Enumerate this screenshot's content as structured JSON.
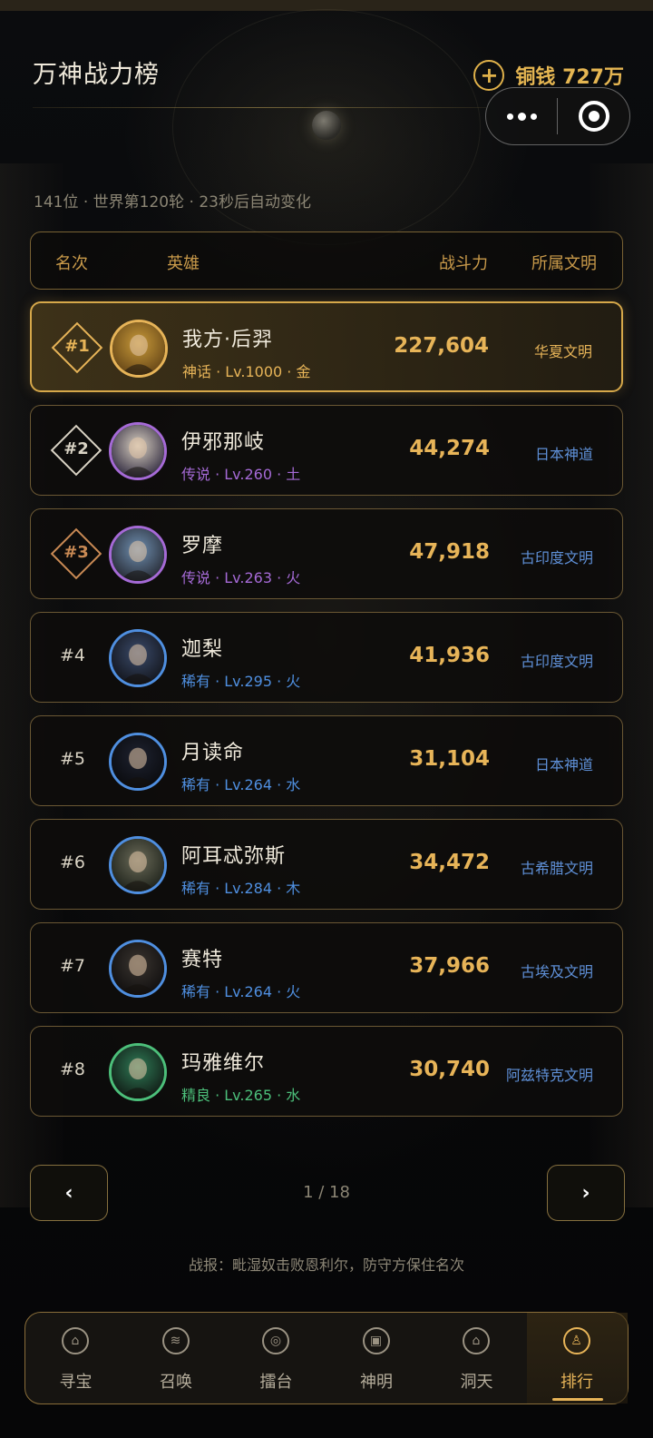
{
  "header": {
    "title": "万神战力榜",
    "coin_label": "铜钱 727万",
    "coin_add_icon": "plus-circle-icon"
  },
  "capsule": {
    "more_icon": "more-dots-icon",
    "close_icon": "target-icon"
  },
  "subinfo": "141位 · 世界第120轮 · 23秒后自动变化",
  "table_header": {
    "rank": "名次",
    "hero": "英雄",
    "power": "战斗力",
    "civ": "所属文明"
  },
  "rows": [
    {
      "rank": "#1",
      "name": "我方·后羿",
      "meta": "神话 · Lv.1000 · 金",
      "power": "227,604",
      "civ": "华夏文明",
      "rarity_color": "#e7b458"
    },
    {
      "rank": "#2",
      "name": "伊邪那岐",
      "meta": "传说 · Lv.260 · 土",
      "power": "44,274",
      "civ": "日本神道",
      "rarity_color": "#a56ad6"
    },
    {
      "rank": "#3",
      "name": "罗摩",
      "meta": "传说 · Lv.263 · 火",
      "power": "47,918",
      "civ": "古印度文明",
      "rarity_color": "#a56ad6"
    },
    {
      "rank": "#4",
      "name": "迦梨",
      "meta": "稀有 · Lv.295 · 火",
      "power": "41,936",
      "civ": "古印度文明",
      "rarity_color": "#4f8fe0"
    },
    {
      "rank": "#5",
      "name": "月读命",
      "meta": "稀有 · Lv.264 · 水",
      "power": "31,104",
      "civ": "日本神道",
      "rarity_color": "#4f8fe0"
    },
    {
      "rank": "#6",
      "name": "阿耳忒弥斯",
      "meta": "稀有 · Lv.284 · 木",
      "power": "34,472",
      "civ": "古希腊文明",
      "rarity_color": "#4f8fe0"
    },
    {
      "rank": "#7",
      "name": "赛特",
      "meta": "稀有 · Lv.264 · 火",
      "power": "37,966",
      "civ": "古埃及文明",
      "rarity_color": "#4f8fe0"
    },
    {
      "rank": "#8",
      "name": "玛雅维尔",
      "meta": "精良 · Lv.265 · 水",
      "power": "30,740",
      "civ": "阿兹特克文明",
      "rarity_color": "#4cbf7a"
    }
  ],
  "pager": {
    "prev": "‹",
    "next": "›",
    "page": "1 / 18"
  },
  "report": "战报：毗湿奴击败恩利尔，防守方保住名次",
  "tabs": [
    {
      "label": "寻宝",
      "icon": "treasure-icon",
      "glyph": "⌂"
    },
    {
      "label": "召唤",
      "icon": "summon-icon",
      "glyph": "≋"
    },
    {
      "label": "擂台",
      "icon": "arena-icon",
      "glyph": "◎"
    },
    {
      "label": "神明",
      "icon": "deity-icon",
      "glyph": "▣"
    },
    {
      "label": "洞天",
      "icon": "realm-icon",
      "glyph": "⌂"
    },
    {
      "label": "排行",
      "icon": "ranking-icon",
      "glyph": "♙"
    }
  ]
}
